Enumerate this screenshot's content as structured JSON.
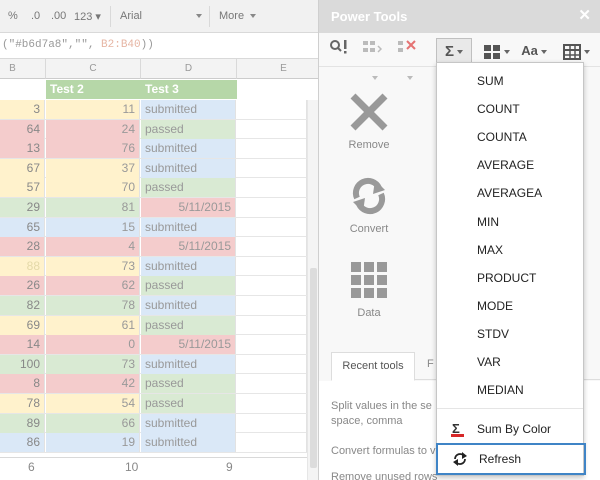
{
  "toolbar": {
    "items": [
      "%",
      ".0",
      ".00",
      "123 ▾"
    ],
    "font": "Arial",
    "more": "More"
  },
  "formula": {
    "prefix": "(\"#b6d7a8\",\"\", ",
    "range": "B2:B40",
    "suffix": "))"
  },
  "sheet": {
    "headers": [
      "B",
      "C",
      "D",
      "E"
    ],
    "labels": [
      "Test 2",
      "Test 3"
    ],
    "rows": [
      {
        "b": "3",
        "c": "11",
        "d": "submitted"
      },
      {
        "b": "64",
        "c": "24",
        "d": "passed"
      },
      {
        "b": "13",
        "c": "76",
        "d": "submitted"
      },
      {
        "b": "67",
        "c": "37",
        "d": "submitted"
      },
      {
        "b": "57",
        "c": "70",
        "d": "passed"
      },
      {
        "b": "29",
        "c": "81",
        "d": "5/11/2015"
      },
      {
        "b": "65",
        "c": "15",
        "d": "submitted"
      },
      {
        "b": "28",
        "c": "4",
        "d": "5/11/2015"
      },
      {
        "b": "88",
        "c": "73",
        "d": "submitted"
      },
      {
        "b": "26",
        "c": "62",
        "d": "passed"
      },
      {
        "b": "82",
        "c": "78",
        "d": "submitted"
      },
      {
        "b": "69",
        "c": "61",
        "d": "passed"
      },
      {
        "b": "14",
        "c": "0",
        "d": "5/11/2015"
      },
      {
        "b": "100",
        "c": "73",
        "d": "submitted"
      },
      {
        "b": "8",
        "c": "42",
        "d": "passed"
      },
      {
        "b": "78",
        "c": "54",
        "d": "passed"
      },
      {
        "b": "89",
        "c": "66",
        "d": "submitted"
      },
      {
        "b": "86",
        "c": "19",
        "d": "submitted"
      }
    ],
    "totals": [
      "6",
      "10",
      "9"
    ]
  },
  "panel": {
    "title": "Power Tools",
    "close": "✕",
    "tools": [
      {
        "label": "Remove",
        "icon": "x-icon"
      },
      {
        "label": "Convert",
        "icon": "convert-icon"
      },
      {
        "label": "Data",
        "icon": "grid-icon"
      }
    ],
    "tabs": {
      "active": "Recent tools",
      "other": "F"
    },
    "recent": [
      "Split values in the se space, comma",
      "Convert formulas to v",
      "Remove unused rows"
    ]
  },
  "functions_menu": {
    "items": [
      "SUM",
      "COUNT",
      "COUNTA",
      "AVERAGE",
      "AVERAGEA",
      "MIN",
      "MAX",
      "PRODUCT",
      "MODE",
      "STDV",
      "VAR",
      "MEDIAN"
    ],
    "sum_by_color": "Sum By Color",
    "refresh": "Refresh"
  },
  "colors": {
    "header_green": "#b6d7a8",
    "light_red": "#f4cccc",
    "light_yellow": "#fff2cc",
    "light_green": "#d9ead3",
    "light_blue": "#dae8f7",
    "highlight_border": "#3f84c6"
  }
}
